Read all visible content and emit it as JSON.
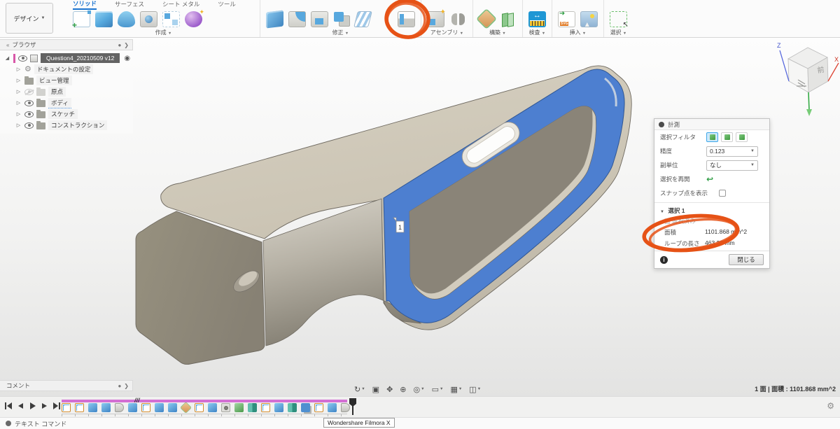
{
  "app": {
    "design_menu": "デザイン"
  },
  "colors": {
    "accent_blue": "#1a73d0",
    "selected_face": "#4d7fd0",
    "annotation_orange": "#e65216",
    "timeline_bar": "#d36fd3"
  },
  "toolbar": {
    "tabs": [
      {
        "label": "ソリッド",
        "active": true
      },
      {
        "label": "サーフェス",
        "active": false
      },
      {
        "label": "シート メタル",
        "active": false
      },
      {
        "label": "ツール",
        "active": false
      }
    ],
    "groups": [
      {
        "label": "作成",
        "icons": [
          {
            "name": "create-sketch-icon",
            "kind": "sketch"
          },
          {
            "name": "extrude-icon",
            "kind": "cube"
          },
          {
            "name": "revolve-icon",
            "kind": "cyl"
          },
          {
            "name": "hole-icon",
            "kind": "hole"
          },
          {
            "name": "pattern-icon",
            "kind": "pattern"
          },
          {
            "name": "form-icon",
            "kind": "form"
          }
        ]
      },
      {
        "label": "修正",
        "icons": [
          {
            "name": "press-pull-icon",
            "kind": "presspull"
          },
          {
            "name": "fillet-icon",
            "kind": "fillet"
          },
          {
            "name": "shell-icon",
            "kind": "shell"
          },
          {
            "name": "combine-icon",
            "kind": "combine"
          },
          {
            "name": "split-body-icon",
            "kind": "planes"
          },
          {
            "name": "move-copy-icon",
            "kind": "move"
          },
          {
            "name": "align-icon",
            "kind": "align"
          }
        ]
      },
      {
        "label": "アセンブリ",
        "icons": [
          {
            "name": "new-component-icon",
            "kind": "newcomp"
          },
          {
            "name": "joint-icon",
            "kind": "joint"
          }
        ]
      },
      {
        "label": "構築",
        "icons": [
          {
            "name": "construction-plane-icon",
            "kind": "planeor"
          },
          {
            "name": "offset-plane-icon",
            "kind": "offsetplane"
          }
        ]
      },
      {
        "label": "検査",
        "icons": [
          {
            "name": "measure-icon",
            "kind": "measure"
          }
        ]
      },
      {
        "label": "挿入",
        "icons": [
          {
            "name": "insert-svg-icon",
            "kind": "insertsvg"
          },
          {
            "name": "insert-image-icon",
            "kind": "insertimg"
          }
        ]
      },
      {
        "label": "選択",
        "icons": [
          {
            "name": "select-icon",
            "kind": "selectbox"
          }
        ]
      }
    ],
    "dropdown_caret": "▼"
  },
  "browser": {
    "title": "ブラウザ",
    "collapse_icon": "«",
    "rows": [
      {
        "label": "Question4_20210509 v12",
        "type": "root"
      },
      {
        "label": "ドキュメントの設定",
        "icon": "gear",
        "eye": "none"
      },
      {
        "label": "ビュー管理",
        "icon": "folder",
        "eye": "none"
      },
      {
        "label": "原点",
        "icon": "folder-dim",
        "eye": "off"
      },
      {
        "label": "ボディ",
        "icon": "folder",
        "eye": "on",
        "underline": true
      },
      {
        "label": "スケッチ",
        "icon": "folder",
        "eye": "on"
      },
      {
        "label": "コンストラクション",
        "icon": "folder",
        "eye": "on"
      }
    ]
  },
  "viewcube": {
    "front_label": "前",
    "axis_z": "Z",
    "axis_x": "X"
  },
  "canvas": {
    "face_marker": "1"
  },
  "dialog": {
    "title": "計測",
    "filter_label": "選択フィルタ",
    "precision_label": "精度",
    "precision_value": "0.123",
    "subunit_label": "副単位",
    "subunit_value": "なし",
    "restart_label": "選択を再開",
    "snap_label": "スナップ点を表示",
    "selection_header": "選択 1",
    "selected_info": "面 選択済み",
    "area_label": "面積",
    "area_value": "1101.868 mm^2",
    "loop_label": "ループの長さ",
    "loop_value": "463.35 mm",
    "close_label": "閉じる"
  },
  "navbar": {
    "icons": [
      {
        "name": "orbit-icon",
        "glyph": "↻",
        "caret": true
      },
      {
        "name": "look-at-icon",
        "glyph": "▣",
        "caret": false
      },
      {
        "name": "pan-icon",
        "glyph": "✥",
        "caret": false
      },
      {
        "name": "zoom-icon",
        "glyph": "⊕",
        "caret": false
      },
      {
        "name": "fit-icon",
        "glyph": "◎",
        "caret": true
      },
      {
        "name": "display-settings-icon",
        "glyph": "▭",
        "caret": true
      },
      {
        "name": "grid-layout-icon",
        "glyph": "▦",
        "caret": true
      },
      {
        "name": "viewports-icon",
        "glyph": "◫",
        "caret": true
      }
    ]
  },
  "status": {
    "right_text": "1 面 | 面積 : 1101.868 mm^2"
  },
  "comments": {
    "title": "コメント"
  },
  "timeline": {
    "scribble": "///",
    "features": [
      "sketch",
      "sketch",
      "extrude",
      "extrude",
      "revolve",
      "extrude",
      "sketch",
      "extrude",
      "extrude",
      "plane",
      "sketch",
      "extrude",
      "hole",
      "offset",
      "mirror",
      "sketch",
      "extrude",
      "mirror",
      "combine",
      "sketch",
      "extrude",
      "revolve"
    ]
  },
  "bottombar": {
    "text_command": "テキスト コマンド",
    "watermark": "Wondershare Filmora X"
  }
}
